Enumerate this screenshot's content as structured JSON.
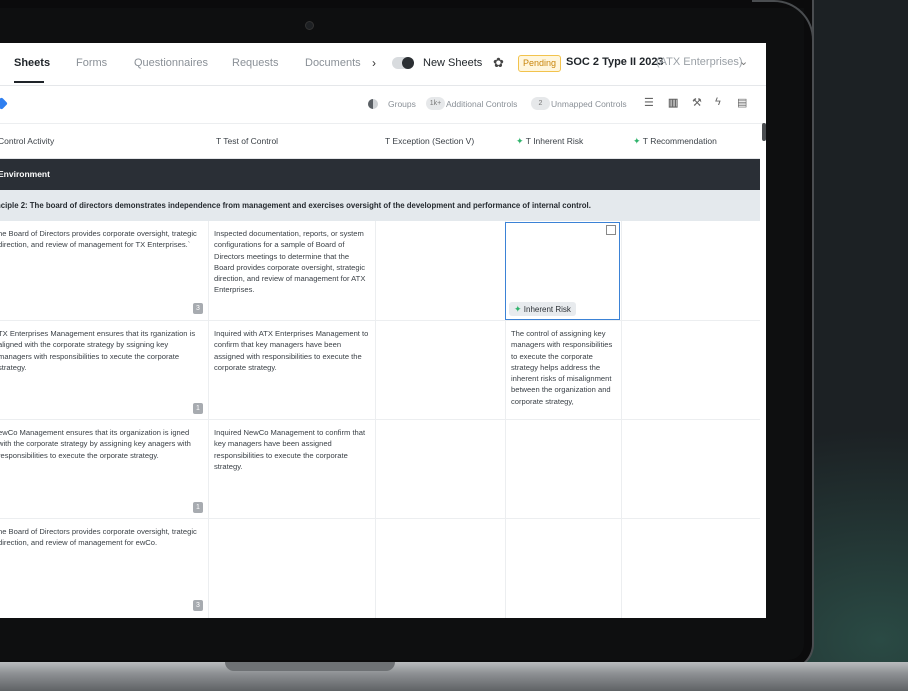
{
  "nav": {
    "tabs": [
      "Sheets",
      "Forms",
      "Questionnaires",
      "Requests",
      "Documents"
    ],
    "active_tab": "Sheets",
    "more_chevron": "›",
    "new_sheets_label": "New Sheets",
    "pending_badge": "Pending",
    "audit_title": "SOC 2 Type II 2023",
    "audit_client": "(ATX Enterprises)",
    "dropdown_chevron": "⌄"
  },
  "toolbar": {
    "groups_label": "Groups",
    "additional_count": "1k+",
    "additional_label": "Additional Controls",
    "unmapped_count": "2",
    "unmapped_label": "Unmapped Controls",
    "icons": [
      "filter-icon",
      "columns-icon",
      "wrench-icon",
      "lightning-icon",
      "notes-icon"
    ]
  },
  "table": {
    "columns": [
      {
        "label": "Control Activity",
        "prefix": ""
      },
      {
        "label": "Test of Control",
        "prefix": "T"
      },
      {
        "label": "Exception (Section V)",
        "prefix": "T"
      },
      {
        "label": "Inherent Risk",
        "prefix": "T",
        "ai": true
      },
      {
        "label": "Recommendation",
        "prefix": "T",
        "ai": true
      }
    ],
    "section_label": "Environment",
    "principle_label": "nciple 2: The board of directors demonstrates independence from management and exercises oversight of the development and performance of internal control.",
    "rows": [
      {
        "control_activity": "he Board of Directors provides corporate oversight, trategic direction, and review of management for TX Enterprises.`",
        "count": "3",
        "test_of_control": "Inspected documentation, reports, or system configurations for a sample of Board of Directors meetings to determine that the Board provides corporate oversight, strategic direction, and review of management for ATX Enterprises.",
        "exception": "",
        "inherent_risk": "",
        "inherent_risk_chip": "Inherent Risk",
        "recommendation": ""
      },
      {
        "control_activity": "TX Enterprises Management ensures that its rganization is aligned with the corporate strategy by ssigning key managers with responsibilities to xecute the corporate strategy.",
        "count": "1",
        "test_of_control": "Inquired with ATX Enterprises Management to confirm that key managers have been assigned with responsibilities to execute the corporate strategy.",
        "exception": "",
        "inherent_risk": "The control of assigning key managers with responsibilities to execute the corporate strategy helps address the inherent risks of misalignment between the organization and corporate strategy,",
        "recommendation": ""
      },
      {
        "control_activity": "ewCo Management ensures that its organization is igned with the corporate strategy by assigning key anagers with responsibilities to execute the orporate strategy.",
        "count": "1",
        "test_of_control": "Inquired NewCo Management to confirm that key managers have been assigned responsibilities to execute the corporate strategy.",
        "exception": "",
        "inherent_risk": "",
        "recommendation": ""
      },
      {
        "control_activity": "he Board of Directors provides corporate oversight, trategic direction, and review of management for ewCo.",
        "count": "3",
        "test_of_control": "",
        "exception": "",
        "inherent_risk": "",
        "recommendation": ""
      }
    ]
  }
}
